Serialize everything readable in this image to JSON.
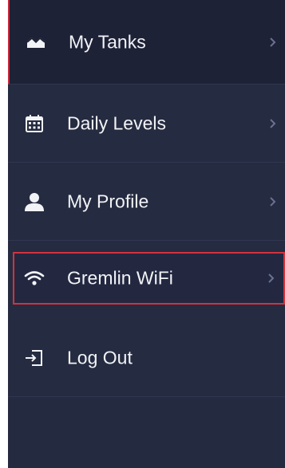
{
  "menu": {
    "items": [
      {
        "label": "My Tanks",
        "icon": "wave-chart-icon"
      },
      {
        "label": "Daily Levels",
        "icon": "calendar-icon"
      },
      {
        "label": "My Profile",
        "icon": "person-icon"
      },
      {
        "label": "Gremlin WiFi",
        "icon": "wifi-icon"
      },
      {
        "label": "Log Out",
        "icon": "logout-icon"
      }
    ]
  },
  "colors": {
    "background": "#252b40",
    "active_background": "#1e2236",
    "active_accent": "#c8283a",
    "highlight_border": "#d3323e",
    "text": "#f2f3f7",
    "chevron": "#6b7190"
  }
}
